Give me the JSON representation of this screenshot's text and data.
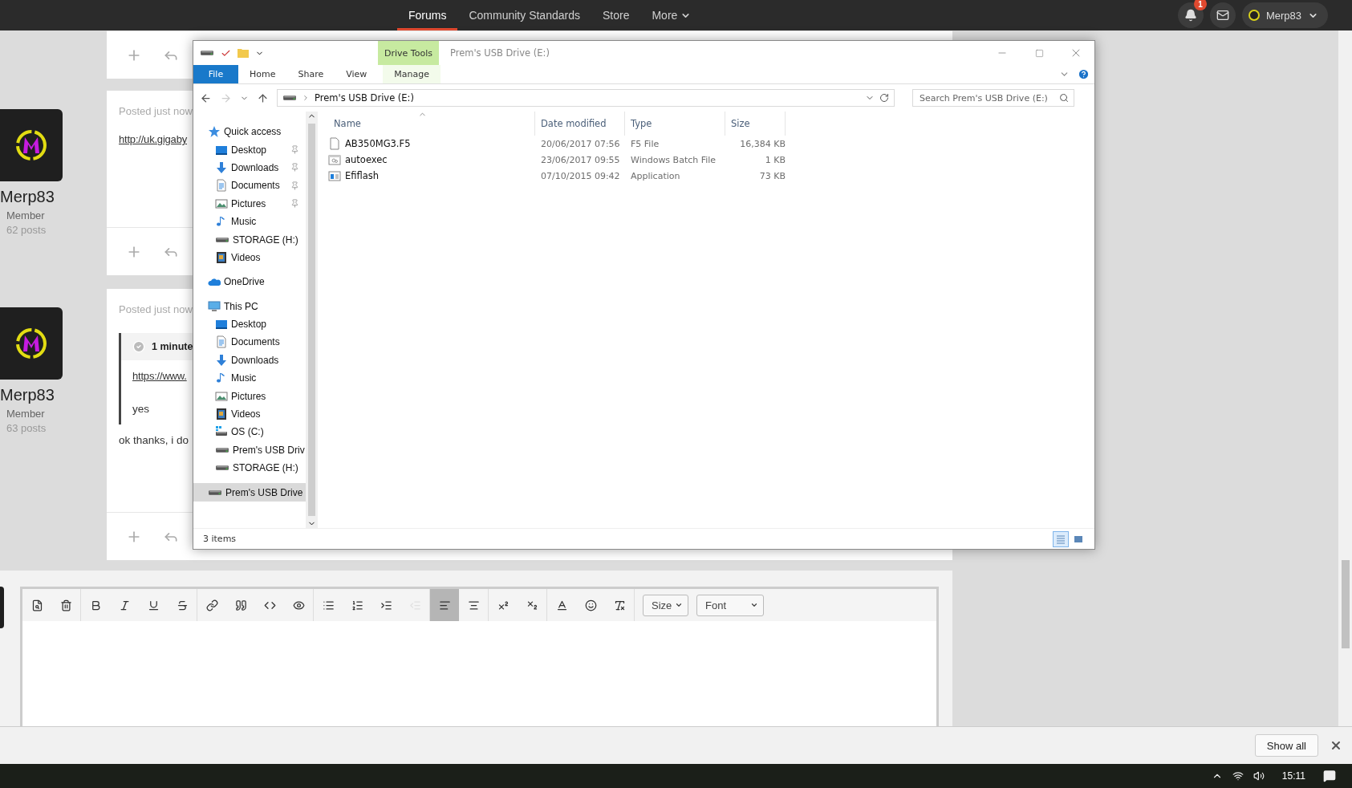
{
  "top_nav": {
    "items": [
      {
        "label": "Forums",
        "selected": true,
        "dropdown": false
      },
      {
        "label": "Community Standards",
        "selected": false,
        "dropdown": false
      },
      {
        "label": "Store",
        "selected": false,
        "dropdown": false
      },
      {
        "label": "More",
        "selected": false,
        "dropdown": true
      }
    ],
    "notifications_badge": "1",
    "user": "Merp83"
  },
  "forum": {
    "posts": [
      {
        "author": "Merp83",
        "role": "Member",
        "post_count": "62 posts",
        "posted": "Posted just now",
        "link": "http://uk.gigaby"
      },
      {
        "author": "Merp83",
        "role": "Member",
        "post_count": "63 posts",
        "posted": "Posted just now",
        "quote": {
          "header": "1 minute",
          "link": "https://www.",
          "text": "yes"
        },
        "body": "ok thanks, i do"
      }
    ]
  },
  "explorer": {
    "context_tab": "Drive Tools",
    "title": "Prem's USB Drive (E:)",
    "ribbon_tabs": [
      {
        "label": "File",
        "selected": true,
        "kind": "file"
      },
      {
        "label": "Home",
        "selected": false,
        "kind": "tab"
      },
      {
        "label": "Share",
        "selected": false,
        "kind": "tab"
      },
      {
        "label": "View",
        "selected": false,
        "kind": "tab"
      },
      {
        "label": "Manage",
        "selected": false,
        "kind": "context"
      }
    ],
    "address": "Prem's USB Drive (E:)",
    "search": {
      "placeholder": "Search Prem's USB Drive (E:)"
    },
    "nav_pane": [
      {
        "label": "Quick access",
        "kind": "star",
        "selected": false,
        "children": [
          {
            "label": "Desktop",
            "kind": "desktop",
            "pinned": true,
            "selected": false
          },
          {
            "label": "Downloads",
            "kind": "downloads",
            "pinned": true,
            "selected": false
          },
          {
            "label": "Documents",
            "kind": "documents",
            "pinned": true,
            "selected": false
          },
          {
            "label": "Pictures",
            "kind": "pictures",
            "pinned": true,
            "selected": false
          },
          {
            "label": "Music",
            "kind": "music",
            "pinned": false,
            "selected": false
          },
          {
            "label": "STORAGE (H:)",
            "kind": "drive",
            "pinned": false,
            "selected": false
          },
          {
            "label": "Videos",
            "kind": "videos",
            "pinned": false,
            "selected": false
          }
        ]
      },
      {
        "label": "OneDrive",
        "kind": "cloud",
        "selected": false
      },
      {
        "label": "This PC",
        "kind": "pc",
        "selected": false,
        "children": [
          {
            "label": "Desktop",
            "kind": "desktop",
            "pinned": false,
            "selected": false
          },
          {
            "label": "Documents",
            "kind": "documents",
            "pinned": false,
            "selected": false
          },
          {
            "label": "Downloads",
            "kind": "downloads",
            "pinned": false,
            "selected": false
          },
          {
            "label": "Music",
            "kind": "music",
            "pinned": false,
            "selected": false
          },
          {
            "label": "Pictures",
            "kind": "pictures",
            "pinned": false,
            "selected": false
          },
          {
            "label": "Videos",
            "kind": "videos",
            "pinned": false,
            "selected": false
          },
          {
            "label": "OS (C:)",
            "kind": "osdrive",
            "pinned": false,
            "selected": false
          },
          {
            "label": "Prem's USB Driv",
            "kind": "drive",
            "pinned": false,
            "selected": false
          },
          {
            "label": "STORAGE (H:)",
            "kind": "drive",
            "pinned": false,
            "selected": false
          }
        ]
      },
      {
        "label": "Prem's USB Drive",
        "kind": "drive",
        "selected": true
      }
    ],
    "columns": [
      "Name",
      "Date modified",
      "Type",
      "Size"
    ],
    "files": [
      {
        "name": "AB350MG3.F5",
        "date": "20/06/2017 07:56",
        "type": "F5 File",
        "size": "16,384 KB",
        "kind": "blank"
      },
      {
        "name": "autoexec",
        "date": "23/06/2017 09:55",
        "type": "Windows Batch File",
        "size": "1 KB",
        "kind": "batch"
      },
      {
        "name": "Efiflash",
        "date": "07/10/2015 09:42",
        "type": "Application",
        "size": "73 KB",
        "kind": "app"
      }
    ],
    "status": "3 items",
    "views": [
      {
        "kind": "details",
        "selected": true
      },
      {
        "kind": "large",
        "selected": false
      }
    ]
  },
  "editor": {
    "toolbar": [
      [
        {
          "kind": "preview",
          "selected": false,
          "disabled": false
        },
        {
          "kind": "trash",
          "selected": false,
          "disabled": false
        }
      ],
      [
        {
          "kind": "bold",
          "selected": false,
          "disabled": false
        },
        {
          "kind": "italic",
          "selected": false,
          "disabled": false
        },
        {
          "kind": "underline",
          "selected": false,
          "disabled": false
        },
        {
          "kind": "strike",
          "selected": false,
          "disabled": false
        }
      ],
      [
        {
          "kind": "link",
          "selected": false,
          "disabled": false
        },
        {
          "kind": "quote",
          "selected": false,
          "disabled": false
        },
        {
          "kind": "code",
          "selected": false,
          "disabled": false
        },
        {
          "kind": "spoiler",
          "selected": false,
          "disabled": false
        }
      ],
      [
        {
          "kind": "bullets",
          "selected": false,
          "disabled": false
        },
        {
          "kind": "numbers",
          "selected": false,
          "disabled": false
        },
        {
          "kind": "indent",
          "selected": false,
          "disabled": false
        },
        {
          "kind": "outdent",
          "selected": false,
          "disabled": true
        }
      ],
      [
        {
          "kind": "align-left",
          "selected": true,
          "disabled": false
        },
        {
          "kind": "align-center",
          "selected": false,
          "disabled": false
        }
      ],
      [
        {
          "kind": "superscript",
          "selected": false,
          "disabled": false
        },
        {
          "kind": "subscript",
          "selected": false,
          "disabled": false
        }
      ],
      [
        {
          "kind": "text-color",
          "selected": false,
          "disabled": false
        },
        {
          "kind": "emoji",
          "selected": false,
          "disabled": false
        },
        {
          "kind": "clear-format",
          "selected": false,
          "disabled": false
        }
      ]
    ],
    "dropdowns": [
      "Size",
      "Font"
    ]
  },
  "download_bar": {
    "button": "Show all"
  },
  "taskbar": {
    "time": "15:11"
  }
}
